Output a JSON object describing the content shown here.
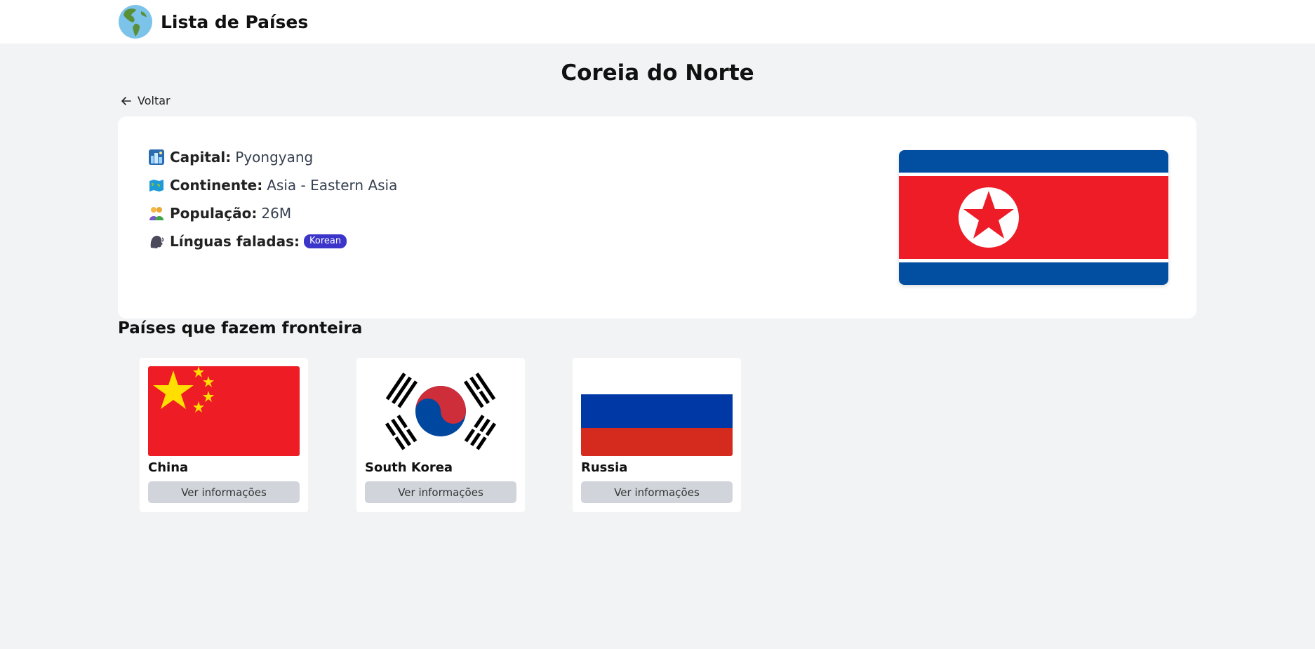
{
  "header": {
    "title": "Lista de Países",
    "logo_icon": "globe-americas-icon"
  },
  "page": {
    "title": "Coreia do Norte",
    "back_label": "Voltar"
  },
  "country": {
    "capital_label": "Capital:",
    "capital": "Pyongyang",
    "continent_label": "Continente:",
    "continent": "Asia - Eastern Asia",
    "population_label": "População:",
    "population": "26M",
    "languages_label": "Línguas faladas:",
    "languages": [
      "Korean"
    ],
    "flag": "north-korea-flag"
  },
  "borders": {
    "title": "Países que fazem fronteira",
    "button_label": "Ver informações",
    "countries": [
      {
        "name": "China",
        "flag": "china-flag"
      },
      {
        "name": "South Korea",
        "flag": "south-korea-flag"
      },
      {
        "name": "Russia",
        "flag": "russia-flag"
      }
    ]
  },
  "colors": {
    "background": "#f2f3f5",
    "badge": "#3b35c9",
    "button": "#d1d5db"
  }
}
